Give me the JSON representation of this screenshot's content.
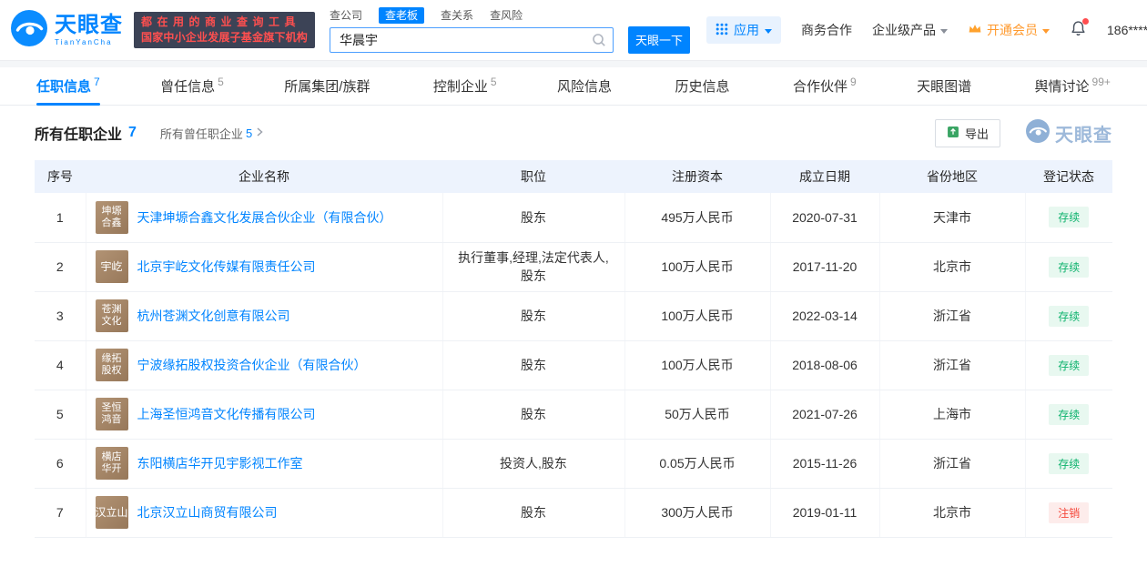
{
  "colors": {
    "brand_blue": "#0084ff",
    "vip_orange": "#ff9a2e",
    "status_green": "#0cb26c",
    "status_red": "#f5483b",
    "badge_bg": "#3c4356",
    "badge_text": "#ff4f4f",
    "icon_brown": "#a5886a",
    "table_header_bg": "#edf3fd"
  },
  "header": {
    "logo": {
      "cn": "天眼查",
      "en": "TianYanCha"
    },
    "badge": {
      "line1": "都在用的商业查询工具",
      "line2": "国家中小企业发展子基金旗下机构"
    },
    "search": {
      "tabs": [
        {
          "label": "查公司"
        },
        {
          "label": "查老板"
        },
        {
          "label": "查关系"
        },
        {
          "label": "查风险"
        }
      ],
      "value": "华晨宇",
      "button": "天眼一下"
    },
    "apps_label": "应用",
    "biz_label": "商务合作",
    "enterprise_label": "企业级产品",
    "vip_label": "开通会员",
    "phone": "186****"
  },
  "nav": {
    "tabs": [
      {
        "label": "任职信息",
        "count": "7"
      },
      {
        "label": "曾任信息",
        "count": "5"
      },
      {
        "label": "所属集团/族群",
        "count": ""
      },
      {
        "label": "控制企业",
        "count": "5"
      },
      {
        "label": "风险信息",
        "count": ""
      },
      {
        "label": "历史信息",
        "count": ""
      },
      {
        "label": "合作伙伴",
        "count": "9"
      },
      {
        "label": "天眼图谱",
        "count": ""
      },
      {
        "label": "舆情讨论",
        "count": "99+"
      }
    ]
  },
  "section": {
    "title": "所有任职企业",
    "count": "7",
    "secondary_label": "所有曾任职企业",
    "secondary_count": "5",
    "export_label": "导出",
    "watermark": "天眼查"
  },
  "table": {
    "headers": [
      "序号",
      "企业名称",
      "职位",
      "注册资本",
      "成立日期",
      "省份地区",
      "登记状态"
    ],
    "rows": [
      {
        "no": "1",
        "icon_lines": [
          "坤塬",
          "合鑫"
        ],
        "company": "天津坤塬合鑫文化发展合伙企业（有限合伙）",
        "position": "股东",
        "capital": "495万人民币",
        "date": "2020-07-31",
        "province": "天津市",
        "status": "存续"
      },
      {
        "no": "2",
        "icon_lines": [
          "宇屹"
        ],
        "company": "北京宇屹文化传媒有限责任公司",
        "position": "执行董事,经理,法定代表人,股东",
        "capital": "100万人民币",
        "date": "2017-11-20",
        "province": "北京市",
        "status": "存续"
      },
      {
        "no": "3",
        "icon_lines": [
          "苍渊",
          "文化"
        ],
        "company": "杭州苍渊文化创意有限公司",
        "position": "股东",
        "capital": "100万人民币",
        "date": "2022-03-14",
        "province": "浙江省",
        "status": "存续"
      },
      {
        "no": "4",
        "icon_lines": [
          "缘拓",
          "股权"
        ],
        "company": "宁波缘拓股权投资合伙企业（有限合伙）",
        "position": "股东",
        "capital": "100万人民币",
        "date": "2018-08-06",
        "province": "浙江省",
        "status": "存续"
      },
      {
        "no": "5",
        "icon_lines": [
          "圣恒",
          "鸿音"
        ],
        "company": "上海圣恒鸿音文化传播有限公司",
        "position": "股东",
        "capital": "50万人民币",
        "date": "2021-07-26",
        "province": "上海市",
        "status": "存续"
      },
      {
        "no": "6",
        "icon_lines": [
          "横店",
          "华开"
        ],
        "company": "东阳横店华开见宇影视工作室",
        "position": "投资人,股东",
        "capital": "0.05万人民币",
        "date": "2015-11-26",
        "province": "浙江省",
        "status": "存续"
      },
      {
        "no": "7",
        "icon_lines": [
          "汉立山"
        ],
        "company": "北京汉立山商贸有限公司",
        "position": "股东",
        "capital": "300万人民币",
        "date": "2019-01-11",
        "province": "北京市",
        "status": "注销"
      }
    ]
  }
}
